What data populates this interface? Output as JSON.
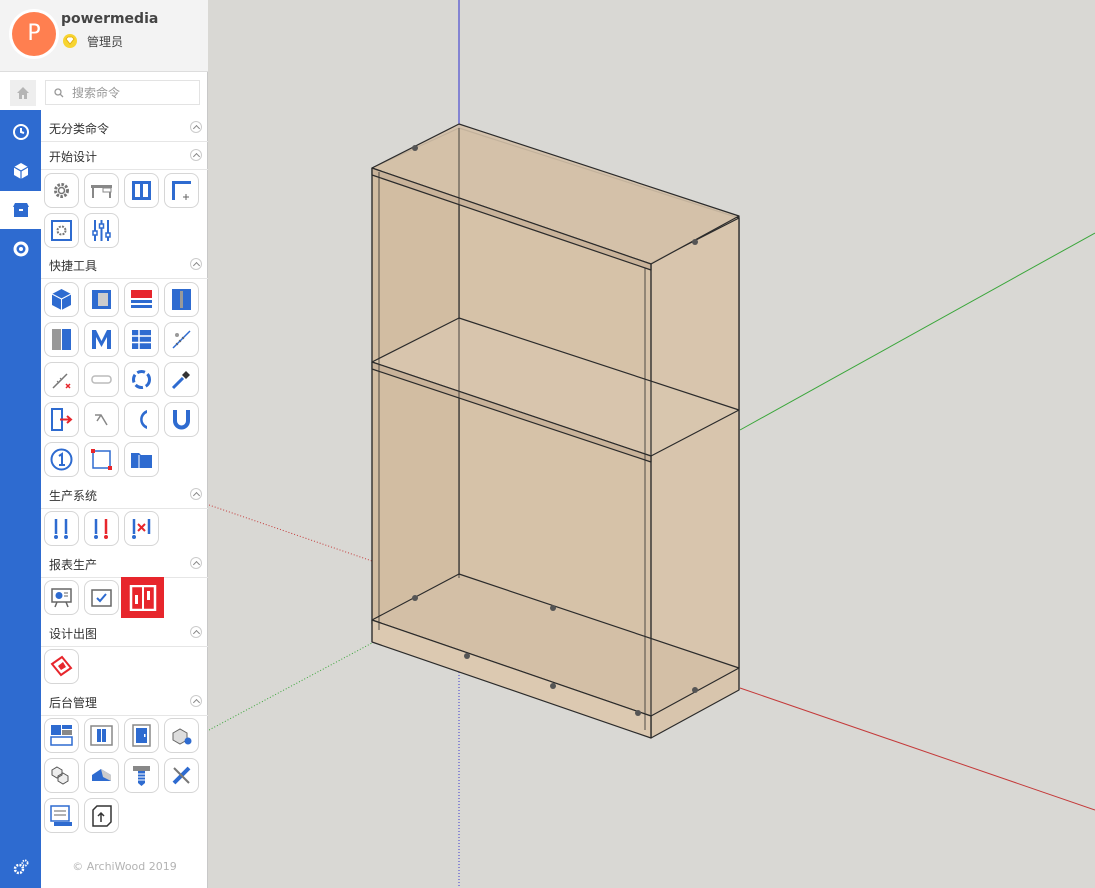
{
  "user": {
    "initial": "P",
    "name": "powermedia",
    "role": "管理员"
  },
  "search": {
    "placeholder": "搜索命令"
  },
  "sections": [
    {
      "label": "无分类命令"
    },
    {
      "label": "开始设计"
    },
    {
      "label": "快捷工具"
    },
    {
      "label": "生产系统"
    },
    {
      "label": "报表生产"
    },
    {
      "label": "设计出图"
    },
    {
      "label": "后台管理"
    }
  ],
  "left_nav": [
    "home-icon",
    "clock-icon",
    "cube-icon",
    "box-icon",
    "refresh-icon",
    "settings-icon"
  ],
  "footer": {
    "copyright": "© ArchiWood 2019"
  },
  "colors": {
    "accent": "#2e6bd0",
    "avatar": "#ff7f50",
    "selected": "#e7262c",
    "viewport_bg": "#d9d8d4",
    "wood": "#d9c4ab"
  }
}
